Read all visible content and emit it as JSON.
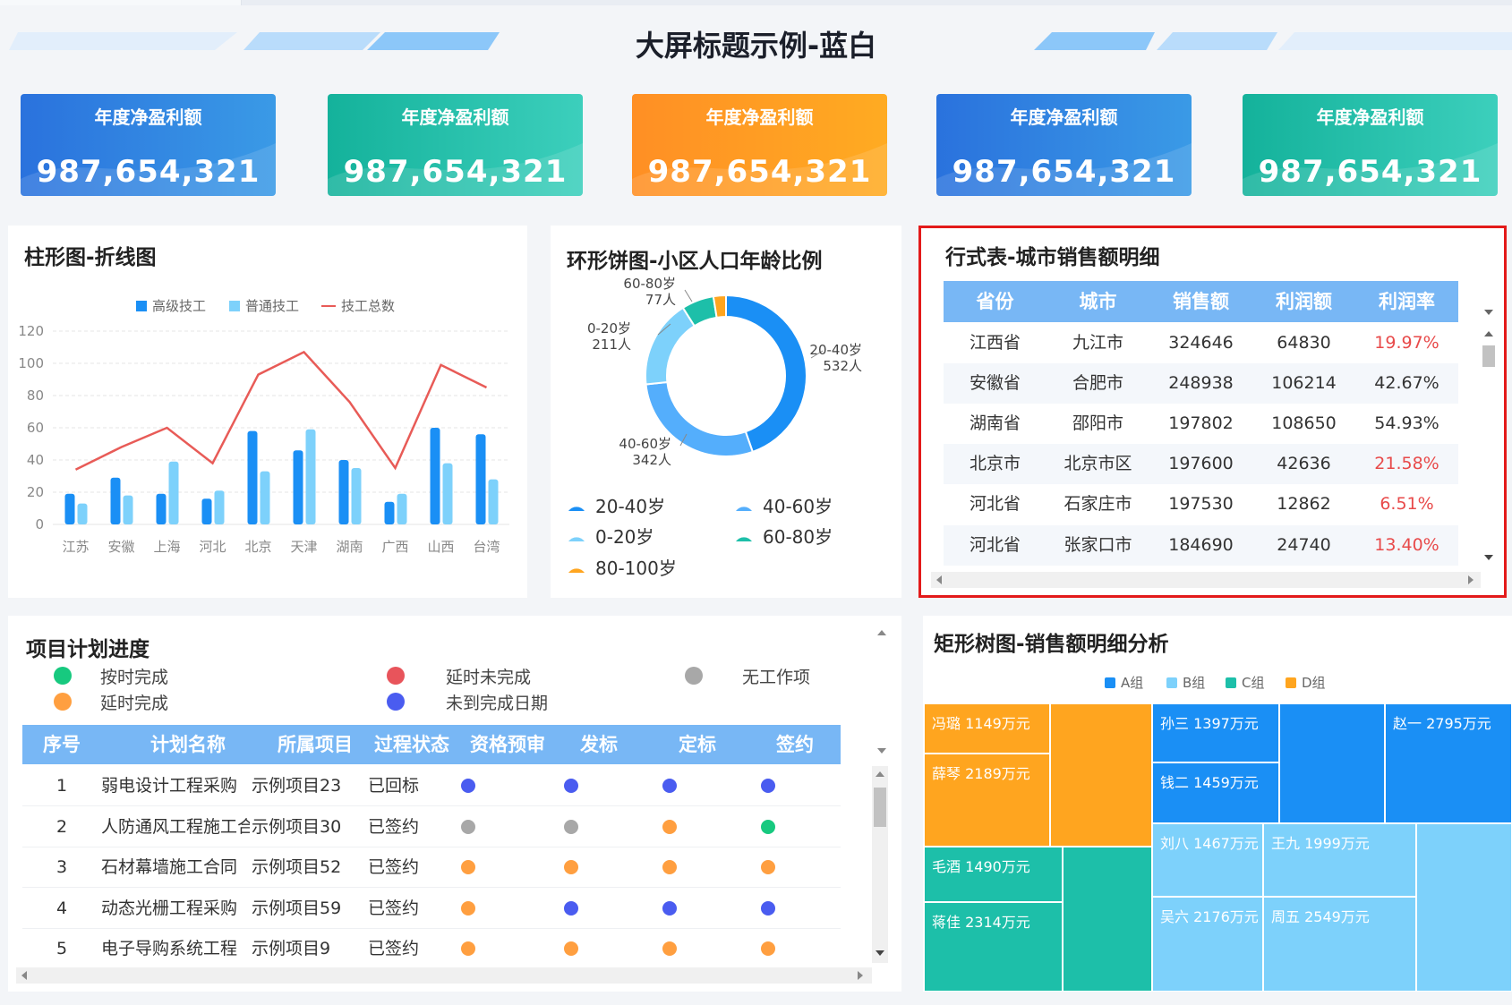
{
  "header": {
    "title": "大屏标题示例-蓝白"
  },
  "kpis": [
    {
      "title": "年度净盈利额",
      "value": "987,654,321",
      "color": "#2a72dd"
    },
    {
      "title": "年度净盈利额",
      "value": "987,654,321",
      "color": "#14b29b"
    },
    {
      "title": "年度净盈利额",
      "value": "987,654,321",
      "color": "#ff8f24"
    },
    {
      "title": "年度净盈利额",
      "value": "987,654,321",
      "color": "#2a72dd"
    },
    {
      "title": "年度净盈利额",
      "value": "987,654,321",
      "color": "#14b29b"
    }
  ],
  "bar_panel": {
    "title": "柱形图-折线图",
    "legend": [
      "高级技工",
      "普通技工",
      "技工总数"
    ]
  },
  "donut_panel": {
    "title": "环形饼图-小区人口年龄比例",
    "labels": [
      {
        "range": "20-40岁",
        "count": "532人"
      },
      {
        "range": "40-60岁",
        "count": "342人"
      },
      {
        "range": "0-20岁",
        "count": "211人"
      },
      {
        "range": "60-80岁",
        "count": "77人"
      }
    ],
    "legend": [
      "20-40岁",
      "40-60岁",
      "0-20岁",
      "60-80岁",
      "80-100岁"
    ]
  },
  "row_table": {
    "title": "行式表-城市销售额明细",
    "columns": [
      "省份",
      "城市",
      "销售额",
      "利润额",
      "利润率"
    ],
    "rows": [
      [
        "江西省",
        "九江市",
        "324646",
        "64830",
        "19.97%"
      ],
      [
        "安徽省",
        "合肥市",
        "248938",
        "106214",
        "42.67%"
      ],
      [
        "湖南省",
        "邵阳市",
        "197802",
        "108650",
        "54.93%"
      ],
      [
        "北京市",
        "北京市区",
        "197600",
        "42636",
        "21.58%"
      ],
      [
        "河北省",
        "石家庄市",
        "197530",
        "12862",
        "6.51%"
      ],
      [
        "河北省",
        "张家口市",
        "184690",
        "24740",
        "13.40%"
      ]
    ],
    "red_rows": [
      0,
      3,
      4,
      5
    ]
  },
  "project_panel": {
    "title": "项目计划进度",
    "status_legend": [
      {
        "label": "按时完成",
        "color": "#17c97f"
      },
      {
        "label": "延时完成",
        "color": "#ff9f40"
      },
      {
        "label": "延时未完成",
        "color": "#e8545b"
      },
      {
        "label": "未到完成日期",
        "color": "#4a5cf0"
      },
      {
        "label": "无工作项",
        "color": "#a8a8a8"
      }
    ],
    "columns": [
      "序号",
      "计划名称",
      "所属项目",
      "过程状态",
      "资格预审",
      "发标",
      "定标",
      "签约"
    ],
    "rows": [
      {
        "no": "1",
        "name": "弱电设计工程采购",
        "project": "示例项目23",
        "status": "已回标",
        "dots": [
          "#4a5cf0",
          "#4a5cf0",
          "#4a5cf0",
          "#4a5cf0"
        ]
      },
      {
        "no": "2",
        "name": "人防通风工程施工合同",
        "project": "示例项目30",
        "status": "已签约",
        "dots": [
          "#a8a8a8",
          "#a8a8a8",
          "#ff9f40",
          "#17c97f"
        ]
      },
      {
        "no": "3",
        "name": "石材幕墙施工合同",
        "project": "示例项目52",
        "status": "已签约",
        "dots": [
          "#ff9f40",
          "#ff9f40",
          "#ff9f40",
          "#ff9f40"
        ]
      },
      {
        "no": "4",
        "name": "动态光栅工程采购",
        "project": "示例项目59",
        "status": "已签约",
        "dots": [
          "#ff9f40",
          "#4a5cf0",
          "#4a5cf0",
          "#4a5cf0"
        ]
      },
      {
        "no": "5",
        "name": "电子导购系统工程",
        "project": "示例项目9",
        "status": "已签约",
        "dots": [
          "#ff9f40",
          "#ff9f40",
          "#ff9f40",
          "#ff9f40"
        ]
      }
    ]
  },
  "treemap_panel": {
    "title": "矩形树图-销售额明细分析",
    "legend": [
      "A组",
      "B组",
      "C组",
      "D组"
    ],
    "colors": {
      "A": "#1a8ff5",
      "B": "#7dd1fb",
      "C": "#1dbfa9",
      "D": "#ffa51f"
    },
    "cells": [
      {
        "label": "冯璐  1149万元",
        "group": "D"
      },
      {
        "label": "薛琴  2189万元",
        "group": "D"
      },
      {
        "label": "",
        "group": "D"
      },
      {
        "label": "毛酒  1490万元",
        "group": "C"
      },
      {
        "label": "蒋佳  2314万元",
        "group": "C"
      },
      {
        "label": "",
        "group": "C"
      },
      {
        "label": "孙三  1397万元",
        "group": "A"
      },
      {
        "label": "钱二  1459万元",
        "group": "A"
      },
      {
        "label": "",
        "group": "A"
      },
      {
        "label": "赵一  2795万元",
        "group": "A"
      },
      {
        "label": "刘八  1467万元",
        "group": "B"
      },
      {
        "label": "王九  1999万元",
        "group": "B"
      },
      {
        "label": "吴六  2176万元",
        "group": "B"
      },
      {
        "label": "周五  2549万元",
        "group": "B"
      },
      {
        "label": "",
        "group": "B"
      }
    ]
  },
  "chart_data": [
    {
      "type": "bar",
      "title": "柱形图-折线图",
      "categories": [
        "江苏",
        "安徽",
        "上海",
        "河北",
        "北京",
        "天津",
        "湖南",
        "广西",
        "山西",
        "台湾"
      ],
      "series": [
        {
          "name": "高级技工",
          "type": "bar",
          "color": "#1a8ff5",
          "values": [
            19,
            29,
            19,
            16,
            58,
            46,
            40,
            14,
            60,
            56
          ]
        },
        {
          "name": "普通技工",
          "type": "bar",
          "color": "#7dd1fb",
          "values": [
            13,
            18,
            39,
            21,
            33,
            59,
            35,
            19,
            38,
            28
          ]
        },
        {
          "name": "技工总数",
          "type": "line",
          "color": "#e85b57",
          "values": [
            34,
            48,
            60,
            38,
            93,
            107,
            76,
            35,
            99,
            85
          ]
        }
      ],
      "ylim": [
        0,
        120
      ],
      "yticks": [
        0,
        20,
        40,
        60,
        80,
        100,
        120
      ],
      "grid": true,
      "legend": "top-center"
    },
    {
      "type": "pie",
      "title": "环形饼图-小区人口年龄比例",
      "donut": true,
      "slices": [
        {
          "name": "20-40岁",
          "value": 532,
          "color": "#1a8ff5"
        },
        {
          "name": "40-60岁",
          "value": 342,
          "color": "#54aefc"
        },
        {
          "name": "0-20岁",
          "value": 211,
          "color": "#7dd1fb"
        },
        {
          "name": "60-80岁",
          "value": 77,
          "color": "#1dbfa9"
        },
        {
          "name": "80-100岁",
          "value": 30,
          "color": "#ffa51f"
        }
      ],
      "legend": "bottom"
    },
    {
      "type": "table",
      "title": "行式表-城市销售额明细",
      "columns": [
        "省份",
        "城市",
        "销售额",
        "利润额",
        "利润率"
      ]
    }
  ]
}
